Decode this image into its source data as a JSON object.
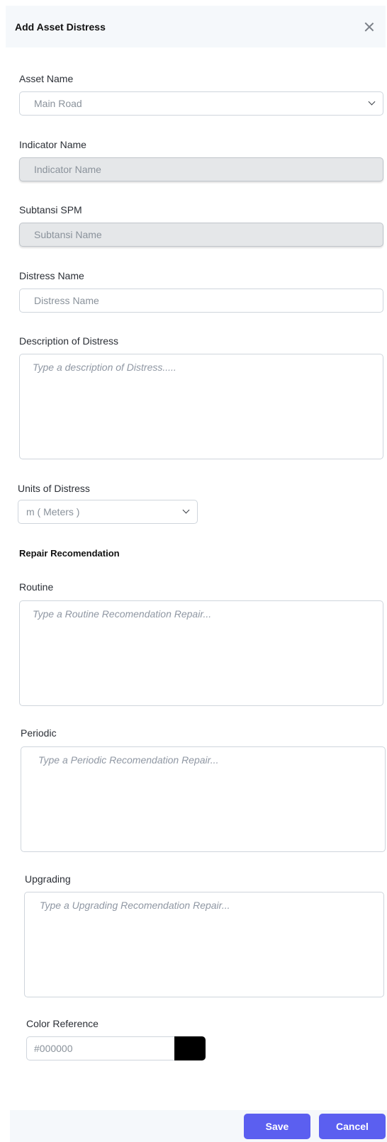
{
  "modal": {
    "title": "Add Asset Distress"
  },
  "form": {
    "asset_name": {
      "label": "Asset Name",
      "value": "Main Road"
    },
    "indicator_name": {
      "label": "Indicator Name",
      "placeholder": "Indicator Name"
    },
    "subtansi_spm": {
      "label": "Subtansi SPM",
      "placeholder": "Subtansi Name"
    },
    "distress_name": {
      "label": "Distress Name",
      "placeholder": "Distress Name"
    },
    "description": {
      "label": "Description of Distress",
      "placeholder": "Type a description of Distress....."
    },
    "units": {
      "label": "Units of Distress",
      "value": "m ( Meters )"
    },
    "repair_section": "Repair Recomendation",
    "routine": {
      "label": "Routine",
      "placeholder": "Type a Routine Recomendation Repair..."
    },
    "periodic": {
      "label": "Periodic",
      "placeholder": "Type a Periodic Recomendation Repair..."
    },
    "upgrading": {
      "label": "Upgrading",
      "placeholder": "Type a Upgrading Recomendation Repair..."
    },
    "color_reference": {
      "label": "Color Reference",
      "value": "#000000"
    }
  },
  "footer": {
    "save_label": "Save",
    "cancel_label": "Cancel"
  },
  "colors": {
    "accent": "#5b5ff0",
    "header_bg": "#f5f8fb",
    "swatch": "#000000"
  }
}
